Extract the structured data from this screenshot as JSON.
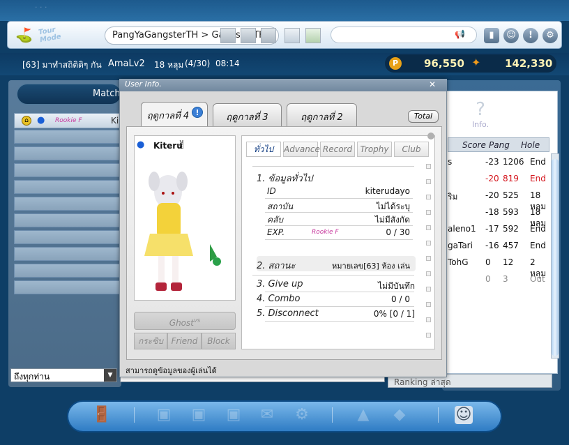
{
  "top_strip_text": "· · ·",
  "toolbar": {
    "mode_label": "Tour Mode",
    "breadcrumb": "PangYaGangsterTH > GangsterTH 1",
    "search_placeholder": ""
  },
  "status": {
    "room": "[63] มาทำสถิติดิๆ กัน",
    "player": "AmaLv2",
    "holes": "18 หลุม",
    "progress": "(4/30)",
    "time": "08:14",
    "pang": "96,550",
    "cookie": "142,330"
  },
  "left": {
    "match_label": "Match",
    "first_row_badge": "Rookie F",
    "first_row_name": "Ki"
  },
  "chat": {
    "target": "ถึงทุกท่าน"
  },
  "right": {
    "info_label": "Info.",
    "headers": [
      "Score",
      "Pang",
      "Hole"
    ],
    "rows": [
      {
        "name": "s",
        "score": "-23",
        "pang": "1206",
        "hole": "End",
        "color": "#111111"
      },
      {
        "name": "",
        "score": "-20",
        "pang": "819",
        "hole": "End",
        "color": "#d4141c"
      },
      {
        "name": "ริม",
        "score": "-20",
        "pang": "525",
        "hole": "18 หลุม",
        "color": "#111111"
      },
      {
        "name": "",
        "score": "-18",
        "pang": "593",
        "hole": "18 หลุม",
        "color": "#111111"
      },
      {
        "name": "aleno1",
        "score": "-17",
        "pang": "592",
        "hole": "End",
        "color": "#111111"
      },
      {
        "name": "gaTari",
        "score": "-16",
        "pang": "457",
        "hole": "End",
        "color": "#111111"
      },
      {
        "name": "TohG",
        "score": "0",
        "pang": "12",
        "hole": "2 หลุม",
        "color": "#111111"
      },
      {
        "name": "",
        "score": "0",
        "pang": "3",
        "hole": "Out",
        "color": "#8a8a8a"
      }
    ],
    "ranking_label": "Ranking ล่าสุด"
  },
  "dialog": {
    "title": "User Info.",
    "close": "✕",
    "season_tabs": [
      "ฤดูกาลที่ 4",
      "ฤดูกาลที่ 3",
      "ฤดูกาลที่ 2"
    ],
    "total": "Total",
    "char_name": "Kiteru",
    "ghost": "Ghost",
    "ghost_sup": "VS",
    "btn_guild": "กระซิบ",
    "btn_friend": "Friend",
    "btn_block": "Block",
    "info_tabs": [
      "ทั่วไป",
      "Advance",
      "Record",
      "Trophy",
      "Club"
    ],
    "section1": "1. ข้อมูลทั่วไป",
    "fields": [
      {
        "label": "ID",
        "value": "kiterudayo"
      },
      {
        "label": "สถาบัน",
        "value": "ไม่ได้ระบุ"
      },
      {
        "label": "คลับ",
        "value": "ไม่มีสังกัด"
      }
    ],
    "exp_label": "EXP.",
    "exp_rank": "Rookie F",
    "exp_value": "0 / 30",
    "section2": "2. สถานะ",
    "section2_value": "หมายเลข[63] ห้อง เล่น",
    "section3": "3. Give up",
    "section3_value": "ไม่มีบันทึก",
    "section4": "4. Combo",
    "section4_value": "0 / 0",
    "section5": "5. Disconnect",
    "section5_value": "0% [0 / 1]",
    "footer": "สามารถดูข้อมูลของผู้เล่นได้"
  }
}
